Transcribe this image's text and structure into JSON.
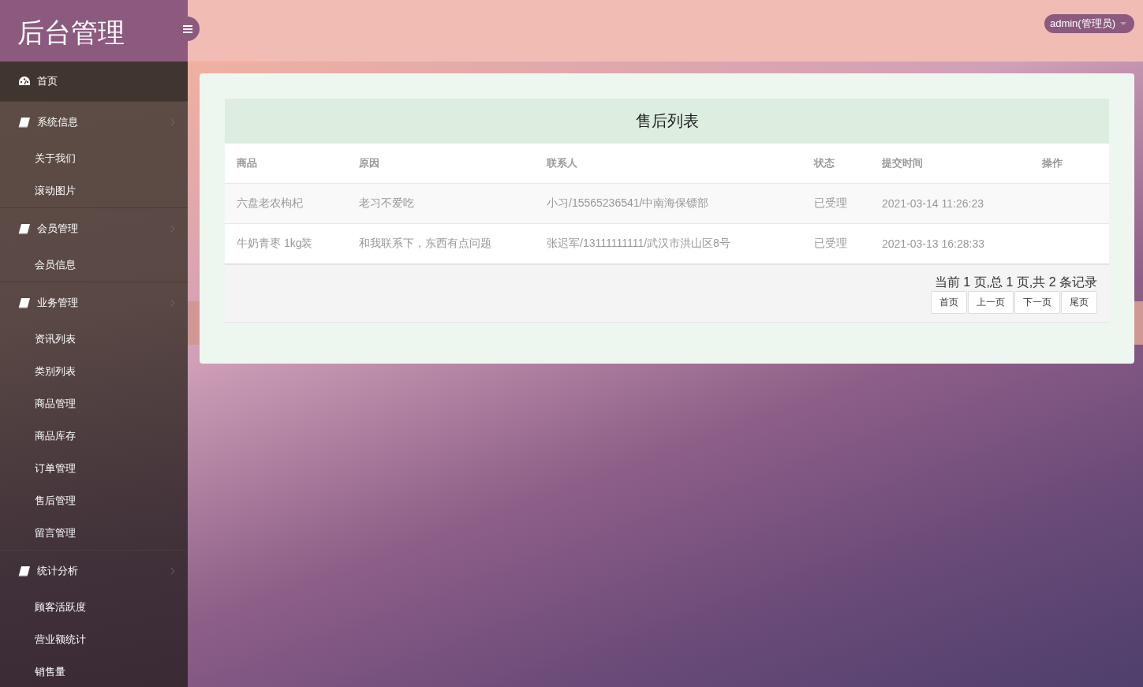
{
  "sidebar": {
    "logo": "后台管理",
    "items": [
      {
        "kind": "link",
        "label": "首页",
        "selected": true
      },
      {
        "kind": "group",
        "label": "系统信息",
        "selected": false,
        "children": [
          {
            "label": "关于我们",
            "selected": false
          },
          {
            "label": "滚动图片",
            "selected": false
          }
        ]
      },
      {
        "kind": "group",
        "label": "会员管理",
        "selected": false,
        "children": [
          {
            "label": "会员信息",
            "selected": false
          }
        ]
      },
      {
        "kind": "group",
        "label": "业务管理",
        "selected": false,
        "children": [
          {
            "label": "资讯列表",
            "selected": false
          },
          {
            "label": "类别列表",
            "selected": false
          },
          {
            "label": "商品管理",
            "selected": false
          },
          {
            "label": "商品库存",
            "selected": false
          },
          {
            "label": "订单管理",
            "selected": false
          },
          {
            "label": "售后管理",
            "selected": false
          },
          {
            "label": "留言管理",
            "selected": false
          }
        ]
      },
      {
        "kind": "group",
        "label": "统计分析",
        "selected": false,
        "children": [
          {
            "label": "顾客活跃度",
            "selected": false
          },
          {
            "label": "营业额统计",
            "selected": false
          },
          {
            "label": "销售量",
            "selected": false
          }
        ]
      }
    ]
  },
  "header": {
    "user": "admin(管理员)"
  },
  "panel": {
    "title": "售后列表",
    "table": {
      "columns": [
        "商品",
        "原因",
        "联系人",
        "状态",
        "提交时间",
        "操作"
      ],
      "rows": [
        [
          "六盘老农枸杞",
          "老习不爱吃",
          "小习/15565236541/中南海保镖部",
          "已受理",
          "2021-03-14 11:26:23"
        ],
        [
          "牛奶青枣 1kg装",
          "和我联系下，东西有点问题",
          "张迟军/13111111111/武汉市洪山区8号",
          "已受理",
          "2021-03-13 16:28:33"
        ]
      ]
    },
    "pagination": {
      "summary": "当前 1 页,总 1 页,共 2 条记录",
      "buttons": [
        "首页",
        "上一页",
        "下一页",
        "尾页"
      ]
    }
  }
}
